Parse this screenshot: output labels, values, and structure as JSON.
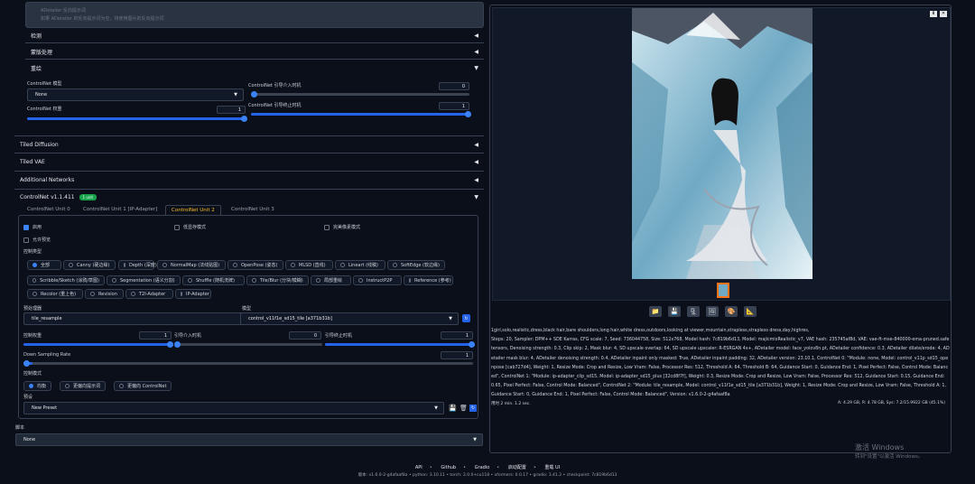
{
  "top_hint": {
    "title": "ADetailer 反向提示词",
    "sub": "如果 ADetailer 的反向提示词为空，将使用图片的反向提示词"
  },
  "accordions": {
    "a1": "检测",
    "a2": "蒙版处理",
    "a3": "重绘"
  },
  "controlnet_mini": {
    "model_label": "ControlNet 模型",
    "model_value": "None",
    "weight_label": "ControlNet 权重",
    "weight_value": "1",
    "guidance_start_label": "ControlNet 引导介入时机",
    "guidance_start_value": "0",
    "guidance_end_label": "ControlNet 引导终止时机",
    "guidance_end_value": "1"
  },
  "sections": {
    "tiled_diffusion": "Tiled Diffusion",
    "tiled_vae": "Tiled VAE",
    "additional_networks": "Additional Networks"
  },
  "controlnet": {
    "title": "ControlNet v1.1.411",
    "badge": "1 unit",
    "tabs": [
      "ControlNet Unit 0",
      "ControlNet Unit 1 [IP-Adapter]",
      "ControlNet Unit 2",
      "ControlNet Unit 3"
    ],
    "enable": "启用",
    "low_vram": "低显存模式",
    "perfect_pixel": "完美像素模式",
    "allow_preview": "允许预览",
    "control_type_label": "控制类型",
    "control_types": [
      "全部",
      "Canny (硬边缘)",
      "Depth (深度)",
      "NormalMap (法线贴图)",
      "OpenPose (姿态)",
      "MLSD (直线)",
      "Lineart (线稿)",
      "SoftEdge (软边缘)",
      "Scribble/Sketch (涂鸦/草图)",
      "Segmentation (语义分割)",
      "Shuffle (随机洗牌)",
      "Tile/Blur (分块/模糊)",
      "局部重绘",
      "InstructP2P",
      "Reference (参考)",
      "Recolor (重上色)",
      "Revision",
      "T2I-Adapter",
      "IP-Adapter"
    ],
    "preprocessor_label": "预处理器",
    "preprocessor_value": "tile_resample",
    "model_label": "模型",
    "model_value": "control_v11f1e_sd15_tile [a371b31b]",
    "weight_label": "控制权重",
    "weight_value": "1",
    "start_label": "引导介入时机",
    "start_value": "0",
    "end_label": "引导终止时机",
    "end_value": "1",
    "down_label": "Down Sampling Rate",
    "down_value": "1",
    "mode_label": "控制模式",
    "modes": [
      "均衡",
      "更偏向提示词",
      "更偏向 ControlNet"
    ],
    "preset_label": "预设",
    "preset_value": "New Preset"
  },
  "script": {
    "label": "脚本",
    "value": "None"
  },
  "output": {
    "info_line1": "1girl,solo,realistic,dress,black hair,bare shoulders,long hair,white dress,outdoors,looking at viewer,mountain,strapless,strapless dress,day,highres,",
    "info_params": "Steps: 20, Sampler: DPM++ SDE Karras, CFG scale: 7, Seed: 736044758, Size: 512x768, Model hash: 7c819b6d13, Model: majicmixRealistic_v7, VAE hash: 235745af8d, VAE: vae-ft-mse-840000-ema-pruned.safetensors, Denoising strength: 0.3, Clip skip: 2, Mask blur: 4, SD upscale overlap: 64, SD upscale upscaler: R-ESRGAN 4x+, ADetailer model: face_yolov8n.pt, ADetailer confidence: 0.3, ADetailer dilate/erode: 4, ADetailer mask blur: 4, ADetailer denoising strength: 0.4, ADetailer inpaint only masked: True, ADetailer inpaint padding: 32, ADetailer version: 23.10.1, ControlNet 0: \"Module: none, Model: control_v11p_sd15_openpose [cab727d4], Weight: 1, Resize Mode: Crop and Resize, Low Vram: False, Processor Res: 512, Threshold A: 64, Threshold B: 64, Guidance Start: 0, Guidance End: 1, Pixel Perfect: False, Control Mode: Balanced\", ControlNet 1: \"Module: ip-adapter_clip_sd15, Model: ip-adapter_sd15_plus [32cd8f7f], Weight: 0.3, Resize Mode: Crop and Resize, Low Vram: False, Processor Res: 512, Guidance Start: 0.15, Guidance End: 0.65, Pixel Perfect: False, Control Mode: Balanced\", ControlNet 2: \"Module: tile_resample, Model: control_v11f1e_sd15_tile [a371b31b], Weight: 1, Resize Mode: Crop and Resize, Low Vram: False, Threshold A: 1, Guidance Start: 0, Guidance End: 1, Pixel Perfect: False, Control Mode: Balanced\", Version: v1.6.0-2-g4afaaf8a",
    "time": "用时 2 min. 1.2 sec.",
    "vram": "A: 4.29 GB, R: 4.78 GB, Sys: 7.2/15.9922 GB (45.1%)"
  },
  "watermark": {
    "line1": "激活 Windows",
    "line2": "转到\"设置\"以激活 Windows。"
  },
  "footer": {
    "links": [
      "API",
      "Github",
      "Gradio",
      "启动配置",
      "重载 UI"
    ],
    "version": "版本: v1.6.0-2-g4afaaf8a  •  python: 3.10.11  •  torch: 2.0.0+cu118  •  xformers: 0.0.17  •  gradio: 3.41.2  •  checkpoint: 7c819b6d13"
  },
  "colors": {
    "accent": "#2563eb",
    "badge": "#16a34a",
    "active_tab": "#fbbf24"
  }
}
